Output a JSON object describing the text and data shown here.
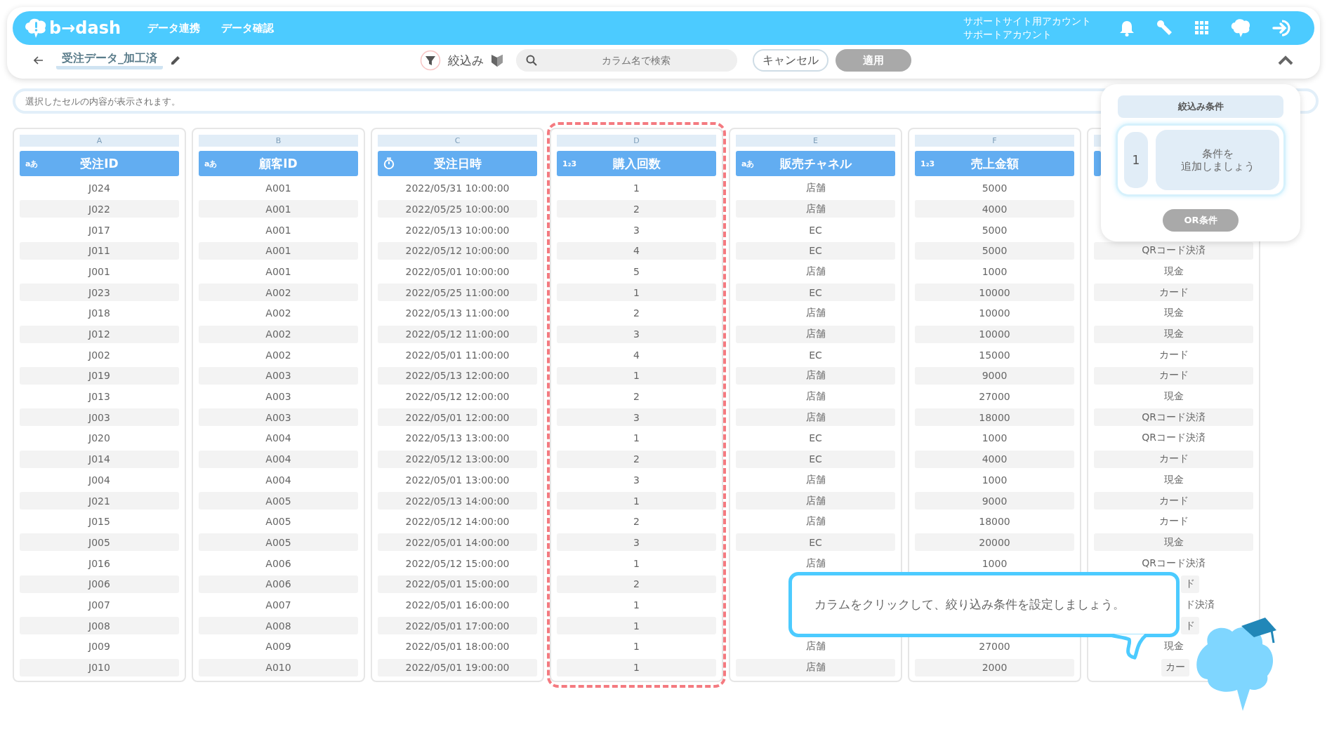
{
  "header": {
    "logo": "b→dash",
    "nav": [
      {
        "label": "データ連携"
      },
      {
        "label": "データ確認"
      }
    ],
    "account": [
      "サポートサイト用アカウント",
      "サポートアカウント"
    ]
  },
  "toolbar": {
    "title": "受注データ_加工済",
    "filter_label": "絞込み",
    "search": {
      "placeholder": "カラム名で検索"
    },
    "cancel": "キャンセル",
    "apply": {
      "label": "適用",
      "disabled": true
    }
  },
  "cell_view": {
    "placeholder": "選択したセルの内容が表示されます。"
  },
  "table": {
    "columns": [
      {
        "letter": "A",
        "title": "受注ID",
        "kind": "text",
        "type_mark": "aあ",
        "highlighted": false,
        "cells": [
          "J024",
          "J022",
          "J017",
          "J011",
          "J001",
          "J023",
          "J018",
          "J012",
          "J002",
          "J019",
          "J013",
          "J003",
          "J020",
          "J014",
          "J004",
          "J021",
          "J015",
          "J005",
          "J016",
          "J006",
          "J007",
          "J008",
          "J009",
          "J010"
        ]
      },
      {
        "letter": "B",
        "title": "顧客ID",
        "kind": "text",
        "type_mark": "aあ",
        "highlighted": false,
        "cells": [
          "A001",
          "A001",
          "A001",
          "A001",
          "A001",
          "A002",
          "A002",
          "A002",
          "A002",
          "A003",
          "A003",
          "A003",
          "A004",
          "A004",
          "A004",
          "A005",
          "A005",
          "A005",
          "A006",
          "A006",
          "A007",
          "A008",
          "A009",
          "A010"
        ]
      },
      {
        "letter": "C",
        "title": "受注日時",
        "kind": "datetime",
        "highlighted": false,
        "cells": [
          "2022/05/31 10:00:00",
          "2022/05/25 10:00:00",
          "2022/05/13 10:00:00",
          "2022/05/12 10:00:00",
          "2022/05/01 10:00:00",
          "2022/05/25 11:00:00",
          "2022/05/13 11:00:00",
          "2022/05/12 11:00:00",
          "2022/05/01 11:00:00",
          "2022/05/13 12:00:00",
          "2022/05/12 12:00:00",
          "2022/05/01 12:00:00",
          "2022/05/13 13:00:00",
          "2022/05/12 13:00:00",
          "2022/05/01 13:00:00",
          "2022/05/13 14:00:00",
          "2022/05/12 14:00:00",
          "2022/05/01 14:00:00",
          "2022/05/12 15:00:00",
          "2022/05/01 15:00:00",
          "2022/05/01 16:00:00",
          "2022/05/01 17:00:00",
          "2022/05/01 18:00:00",
          "2022/05/01 19:00:00"
        ]
      },
      {
        "letter": "D",
        "title": "購入回数",
        "kind": "number",
        "type_mark": "1₂3",
        "highlighted": true,
        "cells": [
          "1",
          "2",
          "3",
          "4",
          "5",
          "1",
          "2",
          "3",
          "4",
          "1",
          "2",
          "3",
          "1",
          "2",
          "3",
          "1",
          "2",
          "3",
          "1",
          "2",
          "1",
          "1",
          "1",
          "1"
        ]
      },
      {
        "letter": "E",
        "title": "販売チャネル",
        "kind": "text",
        "type_mark": "aあ",
        "highlighted": false,
        "cells": [
          "店舗",
          "店舗",
          "EC",
          "EC",
          "店舗",
          "EC",
          "店舗",
          "店舗",
          "EC",
          "店舗",
          "店舗",
          "店舗",
          "EC",
          "EC",
          "店舗",
          "店舗",
          "店舗",
          "EC",
          "店舗",
          null,
          null,
          null,
          "店舗",
          "店舗"
        ]
      },
      {
        "letter": "F",
        "title": "売上金額",
        "kind": "number",
        "type_mark": "1₂3",
        "highlighted": false,
        "cells": [
          "5000",
          "4000",
          "5000",
          "5000",
          "1000",
          "10000",
          "10000",
          "10000",
          "15000",
          "9000",
          "27000",
          "18000",
          "1000",
          "4000",
          "1000",
          "9000",
          "18000",
          "20000",
          "1000",
          null,
          null,
          null,
          "27000",
          "2000"
        ]
      },
      {
        "kind": "text",
        "header_covered": true,
        "highlighted": false,
        "cells": [
          null,
          null,
          null,
          "QRコード決済",
          "現金",
          "カード",
          "現金",
          "現金",
          "カード",
          "カード",
          "現金",
          "QRコード決済",
          "QRコード決済",
          "カード",
          "現金",
          "カード",
          "カード",
          "現金",
          "QRコード決済",
          {
            "text": "ド",
            "cut_left": true
          },
          {
            "text": "ド決済",
            "cut_left": true
          },
          {
            "text": "ド",
            "cut_left": true
          },
          "現金",
          {
            "text": "カー",
            "cut_right": true
          }
        ]
      }
    ]
  },
  "filter_panel": {
    "title": "絞込み条件",
    "groups": [
      {
        "number": "1",
        "hint_lines": [
          "条件を",
          "追加しましょう"
        ]
      }
    ],
    "or_button": {
      "label": "OR条件",
      "disabled": true
    }
  },
  "tip": {
    "text": "カラムをクリックして、絞り込み条件を設定しましょう。"
  }
}
